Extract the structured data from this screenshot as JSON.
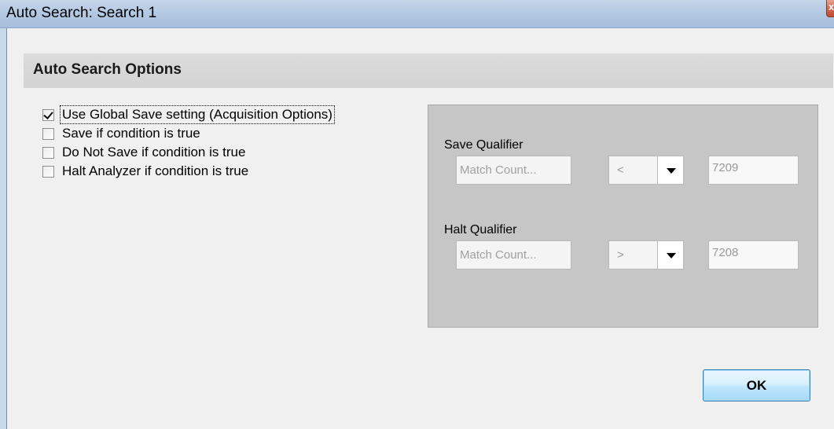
{
  "window": {
    "title": "Auto Search: Search 1",
    "close_glyph": "x"
  },
  "section": {
    "header": "Auto Search Options"
  },
  "options": [
    {
      "label": "Use Global Save setting (Acquisition Options)",
      "checked": true
    },
    {
      "label": "Save if condition is true",
      "checked": false
    },
    {
      "label": "Do Not Save if condition is true",
      "checked": false
    },
    {
      "label": "Halt Analyzer if condition is true",
      "checked": false
    }
  ],
  "save_qualifier": {
    "label": "Save Qualifier",
    "field": "Match Count...",
    "operator": "<",
    "value": "7209"
  },
  "halt_qualifier": {
    "label": "Halt Qualifier",
    "field": "Match Count...",
    "operator": ">",
    "value": "7208"
  },
  "buttons": {
    "ok_label": "OK"
  },
  "icons": {
    "close": "close-icon",
    "dropdown": "chevron-down-icon",
    "check": "checkmark-icon"
  }
}
